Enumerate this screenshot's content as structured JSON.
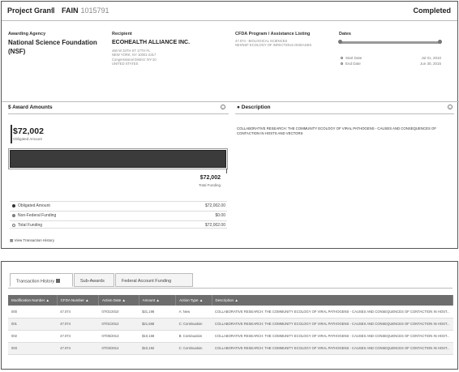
{
  "header": {
    "award_type": "Project Grant",
    "fain_label": "FAIN",
    "fain_value": "1015791",
    "status": "Completed"
  },
  "agency": {
    "label": "Awarding Agency",
    "name": "National Science Foundation (NSF)"
  },
  "recipient": {
    "label": "Recipient",
    "name": "ECOHEALTH ALLIANCE INC.",
    "address_lines": [
      "460 W 34TH ST 17TH FL",
      "NEW YORK, NY 10001-2317",
      "Congressional District: NY-10",
      "UNITED STATES"
    ]
  },
  "cfda": {
    "label": "CFDA Program / Assistance Listing",
    "lines": [
      "47.074 - BIOLOGICAL SCIENCES",
      "NIH/NSF ECOLOGY OF INFECTIOUS DISEASES"
    ]
  },
  "dates": {
    "label": "Dates",
    "start_label": "Start Date",
    "start_value": "Jul 01, 2010",
    "end_label": "End Date",
    "end_value": "Jun 30, 2015"
  },
  "award_amounts": {
    "title": "$ Award Amounts",
    "obligated_value": "$72,002",
    "obligated_label": "Obligated Amount",
    "total_value": "$72,002",
    "total_label": "Total Funding",
    "legend": [
      {
        "label": "Obligated Amount",
        "value": "$72,002.00",
        "color": "#333333"
      },
      {
        "label": "Non-Federal Funding",
        "value": "$0.00",
        "color": "#888888"
      },
      {
        "label": "Total Funding",
        "value": "$72,002.00",
        "color": "#ffffff"
      }
    ],
    "view_history": "View Transaction History"
  },
  "description": {
    "title": "Description",
    "text": "COLLABORATIVE RESEARCH: THE COMMUNITY ECOLOGY OF VIRAL PATHOGENS - CAUSES AND CONSEQUENCES OF CONTACTION IN HOSTS AND VECTORS"
  },
  "tabs": [
    {
      "label": "Transaction History",
      "active": true
    },
    {
      "label": "Sub-Awards",
      "active": false
    },
    {
      "label": "Federal Account Funding",
      "active": false
    }
  ],
  "table": {
    "columns": [
      "Modification Number",
      "CFDA Number",
      "Action Date",
      "Amount",
      "Action Type",
      "Description"
    ],
    "rows": [
      [
        "000",
        "47.074",
        "07/01/2010",
        "$31,198",
        "A: New",
        "COLLABORATIVE RESEARCH: THE COMMUNITY ECOLOGY OF VIRAL PATHOGENS - CAUSES AND CONSEQUENCES OF CONTACTION IN HOST..."
      ],
      [
        "001",
        "47.074",
        "07/01/2012",
        "$21,568",
        "C: Continuation",
        "COLLABORATIVE RESEARCH: THE COMMUNITY ECOLOGY OF VIRAL PATHOGENS - CAUSES AND CONSEQUENCES OF CONTACTION IN HOST..."
      ],
      [
        "002",
        "47.074",
        "07/05/2013",
        "$10,168",
        "B: Continuation",
        "COLLABORATIVE RESEARCH: THE COMMUNITY ECOLOGY OF VIRAL PATHOGENS - CAUSES AND CONSEQUENCES OF CONTACTION IN HOST..."
      ],
      [
        "003",
        "47.074",
        "07/03/2014",
        "$10,192",
        "C: Continuation",
        "COLLABORATIVE RESEARCH: THE COMMUNITY ECOLOGY OF VIRAL PATHOGENS - CAUSES AND CONSEQUENCES OF CONTACTION IN HOST..."
      ]
    ]
  }
}
